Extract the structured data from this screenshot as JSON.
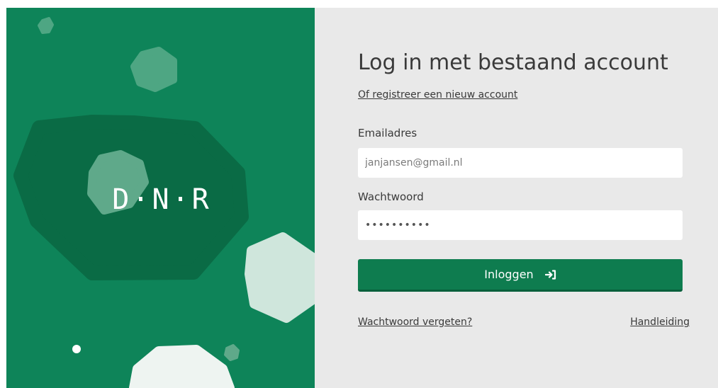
{
  "logo": {
    "text": "D·N·R"
  },
  "login": {
    "title": "Log in met bestaand account",
    "register_link": "Of registreer een nieuw account",
    "email_label": "Emailadres",
    "email_value": "janjansen@gmail.nl",
    "password_label": "Wachtwoord",
    "password_value": "••••••••••",
    "submit_label": "Inloggen",
    "submit_icon": "sign-in-arrow-icon",
    "forgot_link": "Wachtwoord vergeten?",
    "manual_link": "Handleiding"
  },
  "colors": {
    "brand_green": "#0e8459",
    "dark_green": "#0a6b45",
    "button_green": "#0e7c4f",
    "panel_gray": "#e9e9e9"
  }
}
